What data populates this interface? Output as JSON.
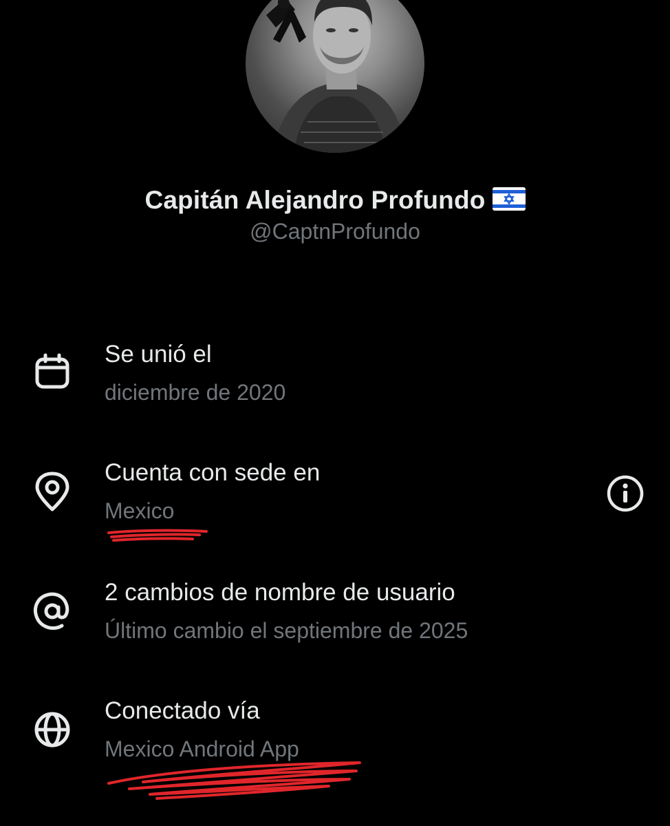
{
  "profile": {
    "name": "Capitán Alejandro Profundo",
    "flag_icon": "israel-flag-icon",
    "handle": "@CaptnProfundo",
    "avatar_icon": "profile-photo-bw-with-mourning-ribbon"
  },
  "about": {
    "joined": {
      "icon": "calendar-icon",
      "title": "Se unió el",
      "value": "diciembre de 2020"
    },
    "location": {
      "icon": "location-pin-icon",
      "title": "Cuenta con sede en",
      "value": "Mexico",
      "info_icon": "info-icon"
    },
    "username_changes": {
      "icon": "at-sign-icon",
      "title": "2 cambios de nombre de usuario",
      "value": "Último cambio el septiembre de 2025"
    },
    "connected": {
      "icon": "globe-icon",
      "title": "Conectado vía",
      "value": "Mexico Android App"
    }
  },
  "colors": {
    "background": "#000000",
    "primary_text": "#e7e9ea",
    "secondary_text": "#71767b",
    "annotation_red": "#e0262b"
  }
}
